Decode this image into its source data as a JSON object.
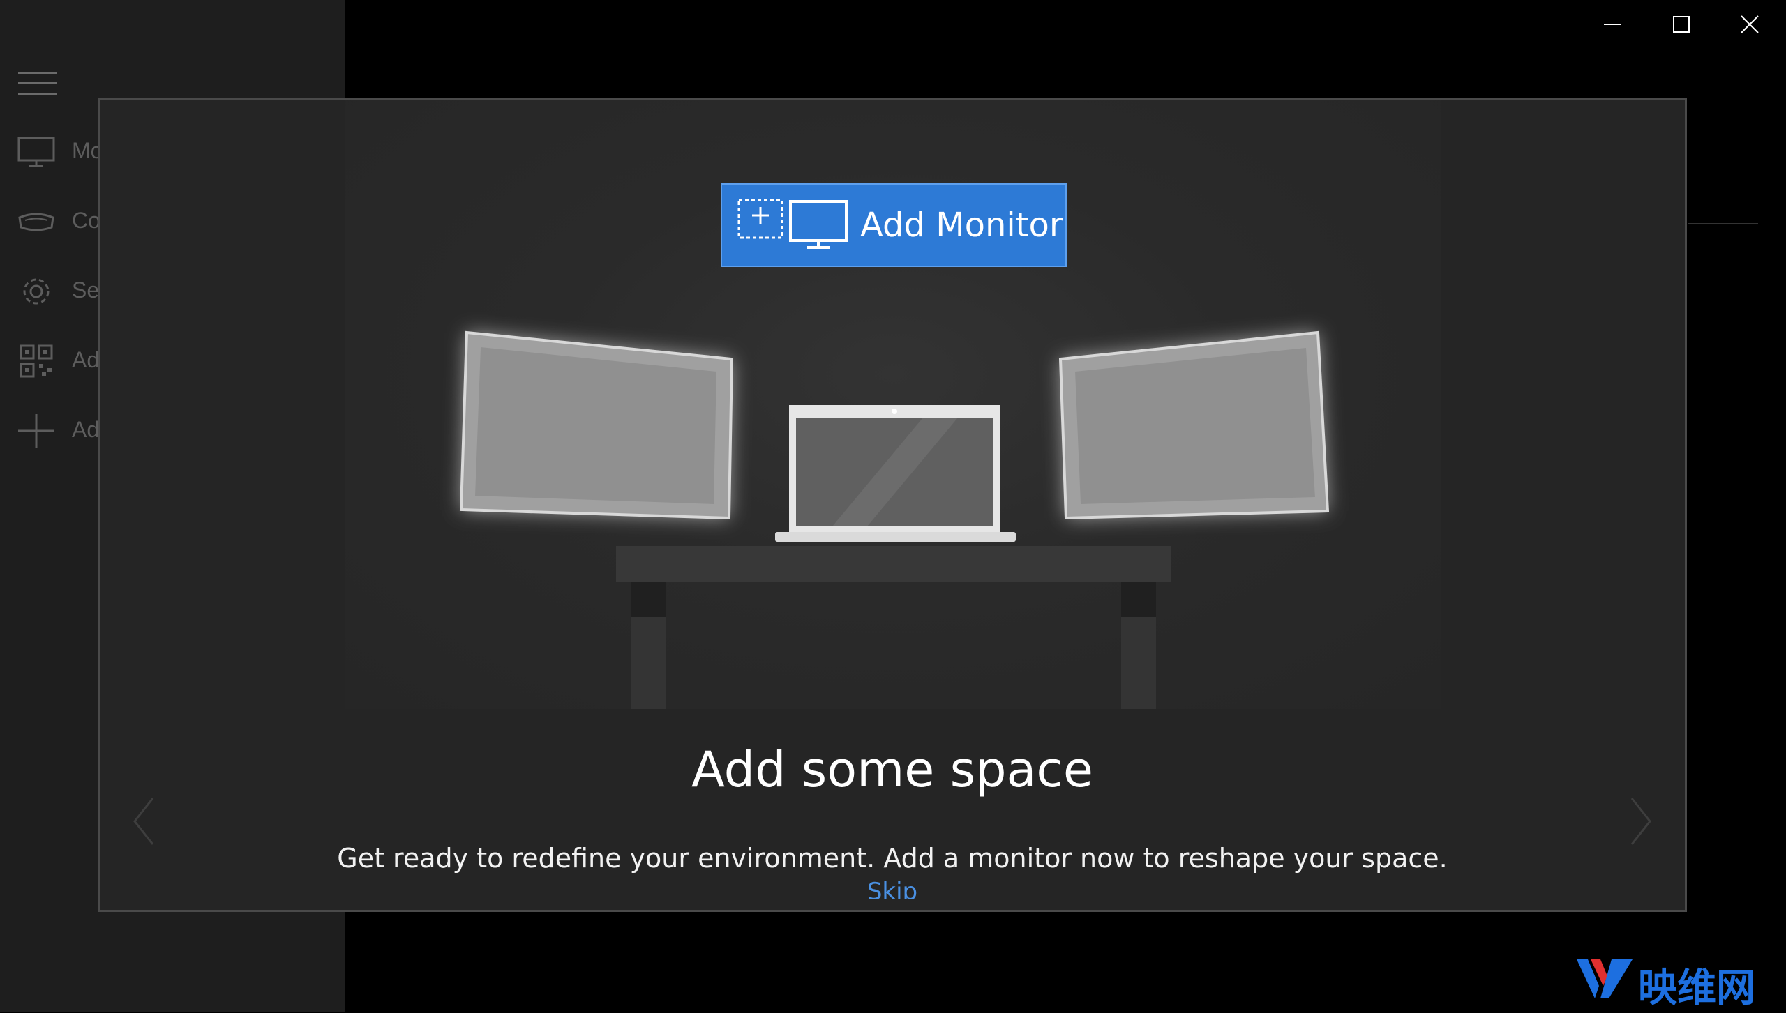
{
  "sidebar": {
    "items": [
      {
        "label": "Mo",
        "icon": "monitor-icon"
      },
      {
        "label": "Co",
        "icon": "headset-icon"
      },
      {
        "label": "Se",
        "icon": "gear-icon"
      },
      {
        "label": "Ad",
        "icon": "qr-code-icon"
      },
      {
        "label": "Ad",
        "icon": "plus-icon"
      }
    ]
  },
  "window_controls": [
    "minimize-icon",
    "maximize-icon",
    "close-icon"
  ],
  "modal": {
    "button_label": "Add Monitor",
    "title": "Add some space",
    "body": "Get ready to redefine your environment. Add a monitor now to reshape your space.",
    "skip_label": "Skip"
  },
  "watermark": {
    "text": "映维网"
  },
  "colors": {
    "accent": "#2d7ad6",
    "link": "#4a90e2",
    "sidebar_bg": "#1e1e1e",
    "modal_bg": "#252525"
  }
}
